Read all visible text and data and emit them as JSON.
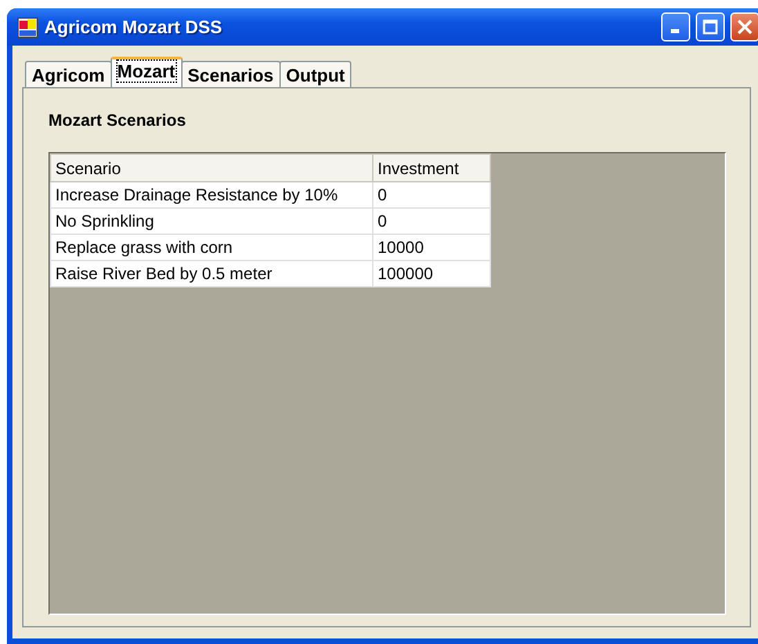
{
  "window": {
    "title": "Agricom Mozart DSS"
  },
  "tabs": [
    {
      "label": "Agricom",
      "selected": false
    },
    {
      "label": "Mozart",
      "selected": true
    },
    {
      "label": "Scenarios",
      "selected": false
    },
    {
      "label": "Output",
      "selected": false
    }
  ],
  "panel": {
    "title": "Mozart Scenarios"
  },
  "table": {
    "columns": [
      "Scenario",
      "Investment"
    ],
    "rows": [
      [
        "Increase Drainage Resistance by 10%",
        "0"
      ],
      [
        "No Sprinkling",
        "0"
      ],
      [
        "Replace grass with corn",
        "10000"
      ],
      [
        "Raise River Bed by 0.5 meter",
        "100000"
      ]
    ]
  }
}
